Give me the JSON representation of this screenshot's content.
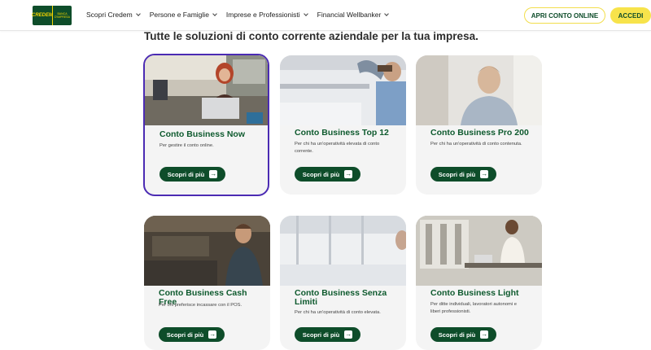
{
  "header": {
    "logo": {
      "left_text": "CREDEM",
      "right_text": "BANCA D'IMPRESA"
    },
    "nav": [
      {
        "label": "Scopri Credem"
      },
      {
        "label": "Persone e Famiglie"
      },
      {
        "label": "Imprese e Professionisti"
      },
      {
        "label": "Financial Wellbanker"
      }
    ],
    "apri_label": "APRI CONTO ONLINE",
    "accedi_label": "ACCEDI"
  },
  "section_title": "Tutte le soluzioni di conto corrente aziendale per la tua impresa.",
  "cards": [
    {
      "title": "Conto Business Now",
      "desc": "Per gestire il conto online.",
      "button": "Scopri di più"
    },
    {
      "title": "Conto Business Top 12",
      "desc": "Per chi ha un'operatività elevata di conto corrente.",
      "button": "Scopri di più"
    },
    {
      "title": "Conto Business Pro 200",
      "desc": "Per chi ha un'operatività di conto contenuta.",
      "button": "Scopri di più"
    },
    {
      "title": "Conto Business Cash Free",
      "desc": "Per chi preferisce incassare con il POS.",
      "button": "Scopri di più"
    },
    {
      "title": "Conto Business Senza Limiti",
      "desc": "Per chi ha un'operatività di conto elevata.",
      "button": "Scopri di più"
    },
    {
      "title": "Conto Business Light",
      "desc": "Per ditte individuali, lavoratori autonomi e liberi professionisti.",
      "button": "Scopri di più"
    }
  ],
  "colors": {
    "brand_green": "#0e4d2a",
    "accent_yellow": "#f7e34b",
    "selected_border": "#4b2bb3"
  }
}
